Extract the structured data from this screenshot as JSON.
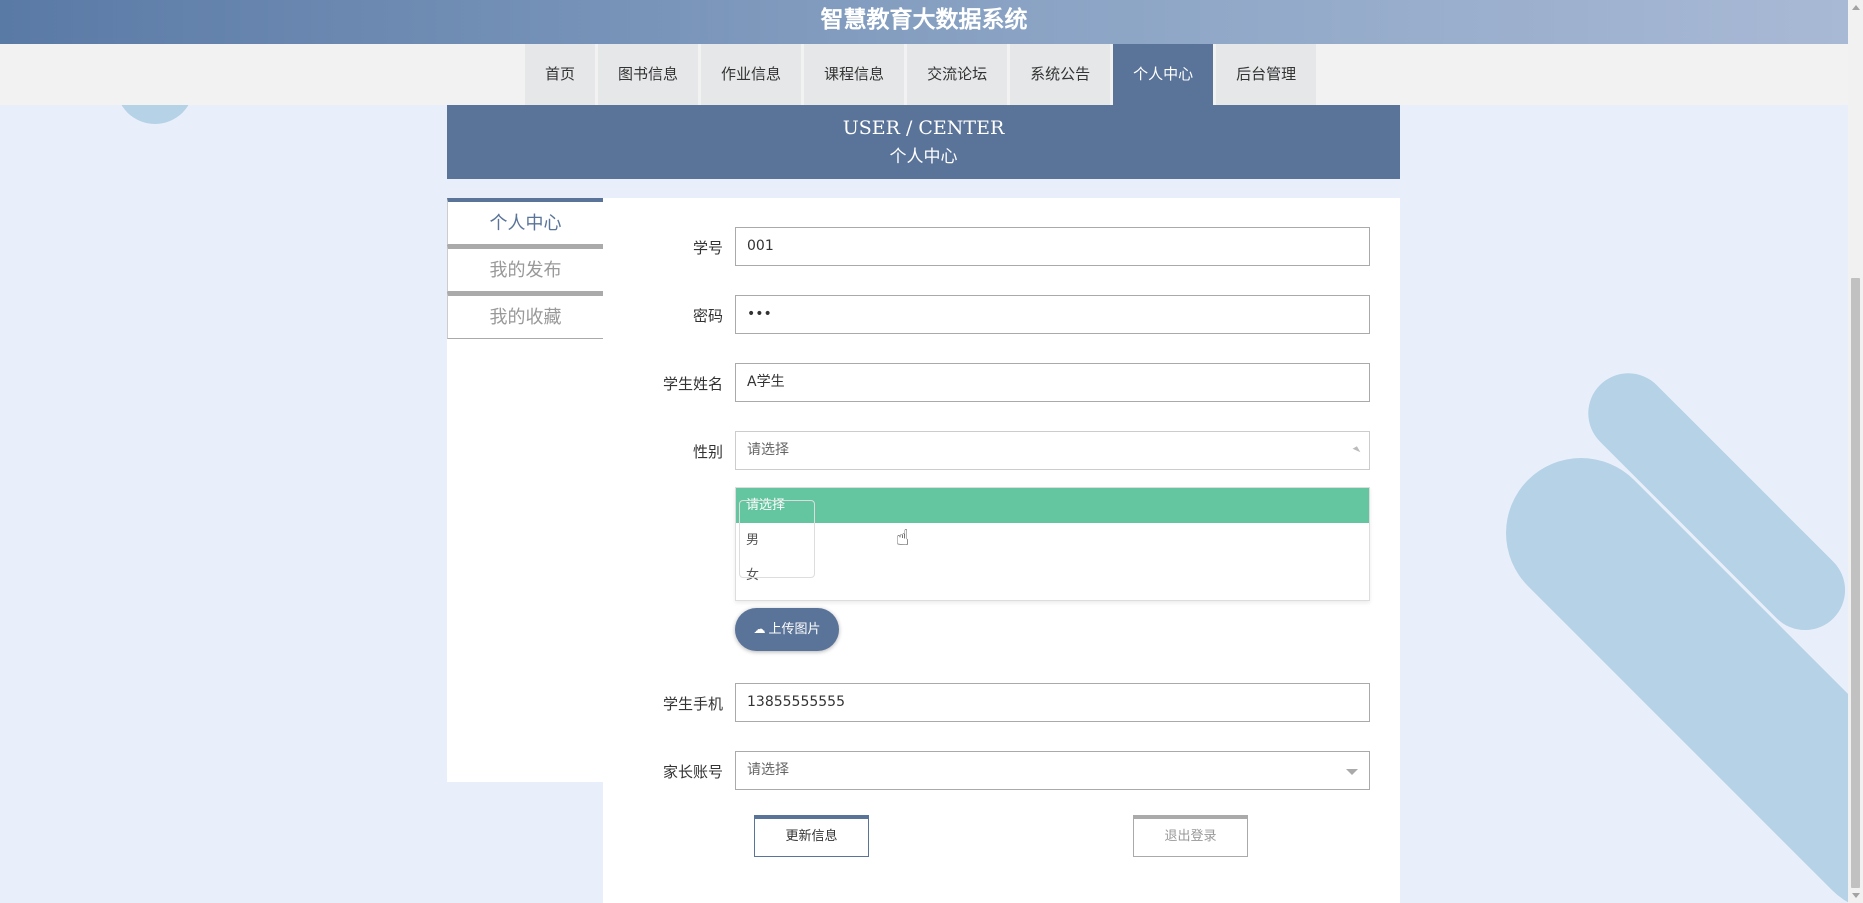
{
  "header": {
    "title": "智慧教育大数据系统"
  },
  "nav": {
    "items": [
      {
        "label": "首页"
      },
      {
        "label": "图书信息"
      },
      {
        "label": "作业信息"
      },
      {
        "label": "课程信息"
      },
      {
        "label": "交流论坛"
      },
      {
        "label": "系统公告"
      },
      {
        "label": "个人中心",
        "active": true
      },
      {
        "label": "后台管理"
      }
    ]
  },
  "banner": {
    "title_en": "USER / CENTER",
    "title_cn": "个人中心"
  },
  "sidebar": {
    "items": [
      {
        "label": "个人中心",
        "active": true
      },
      {
        "label": "我的发布"
      },
      {
        "label": "我的收藏"
      }
    ]
  },
  "form": {
    "student_id": {
      "label": "学号",
      "value": "001"
    },
    "password": {
      "label": "密码",
      "value": "•••"
    },
    "student_name": {
      "label": "学生姓名",
      "value": "A学生"
    },
    "gender": {
      "label": "性别",
      "placeholder": "请选择",
      "options": [
        "请选择",
        "男",
        "女"
      ],
      "highlighted_option": "请选择"
    },
    "upload_button": "上传图片",
    "phone": {
      "label": "学生手机",
      "value": "13855555555"
    },
    "parent_account": {
      "label": "家长账号",
      "placeholder": "请选择"
    },
    "update_button": "更新信息",
    "logout_button": "退出登录"
  },
  "colors": {
    "header_start": "#5a7aa6",
    "nav_active": "#5a7399",
    "dropdown_highlight": "#63c6a0",
    "background": "#e9effa",
    "decoration": "#b5d2e6"
  },
  "icons": {
    "upload": "cloud-upload-icon",
    "cursor": "hand-pointer-icon"
  }
}
